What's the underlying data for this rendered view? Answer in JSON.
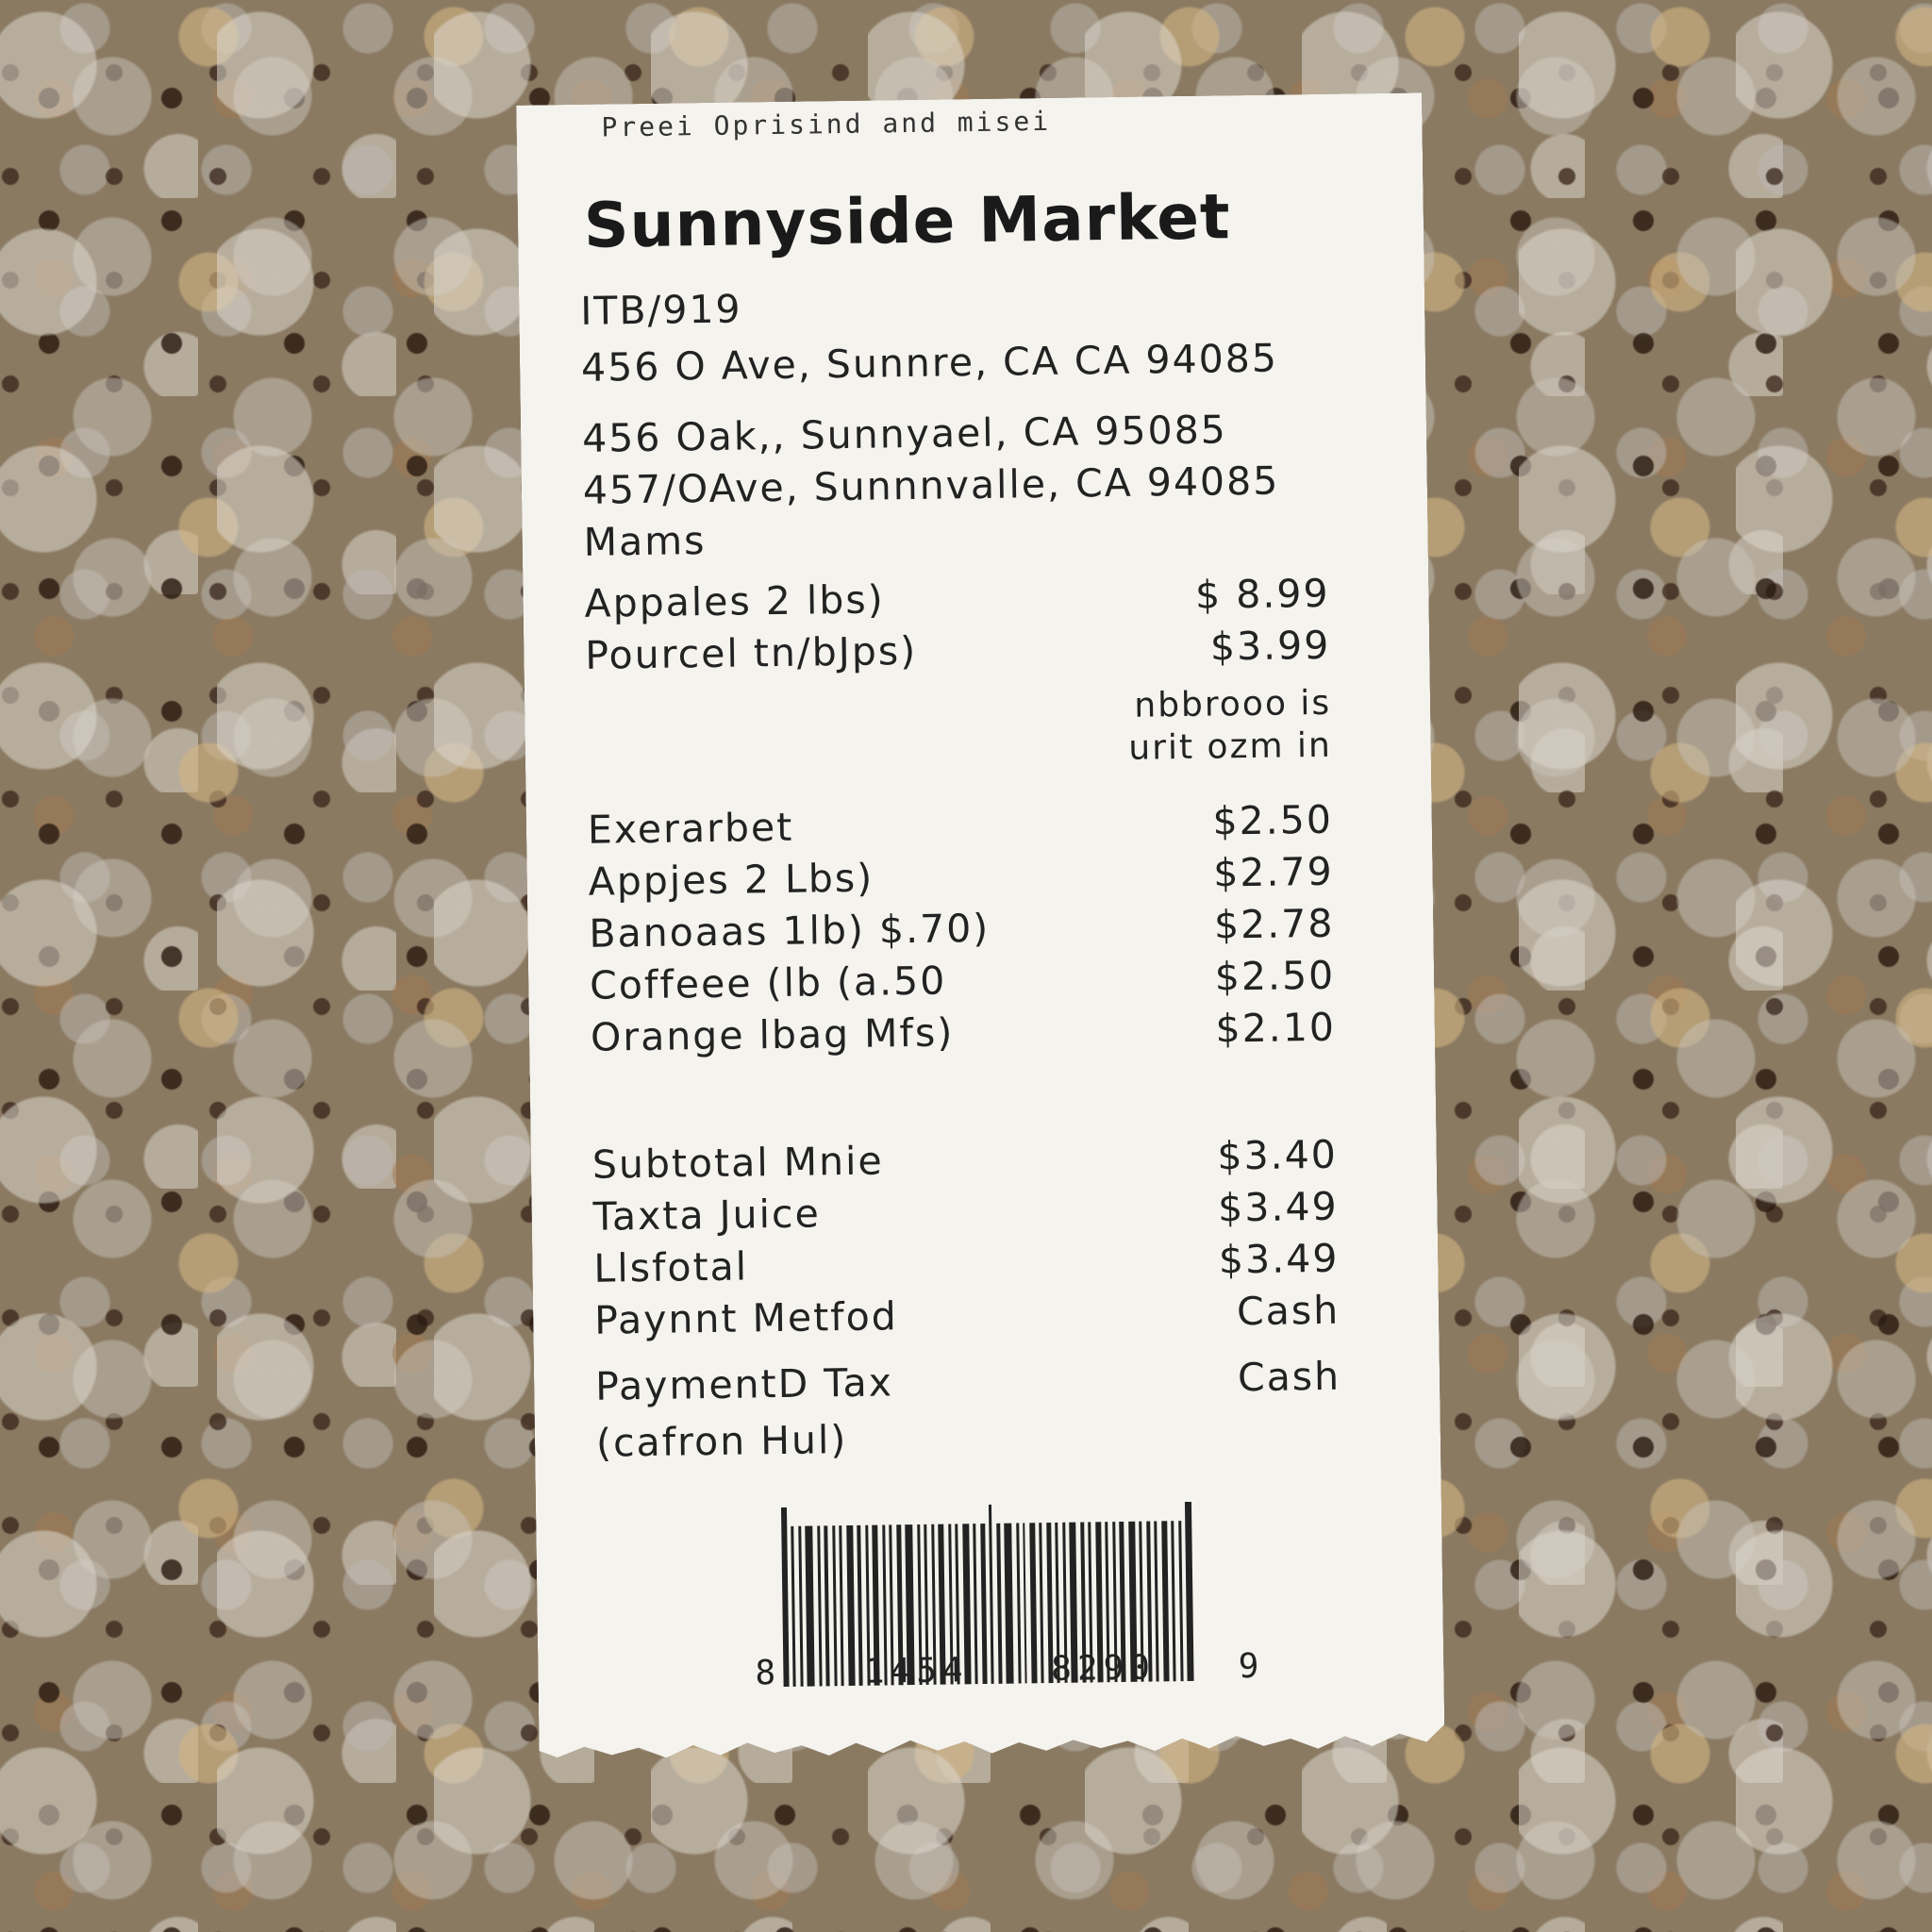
{
  "receipt": {
    "header_note": "Preei Oprisind and misei",
    "store_name": "Sunnyside Market",
    "code_line": "ITB/919",
    "address_lines": [
      "456 O Ave, Sunnre, CA CA 94085",
      "456 Oak,, Sunnyael, CA 95085",
      "457/OAve, Sunnnvalle, CA 94085",
      "Mams"
    ],
    "items": [
      {
        "name": "Appales 2 lbs)",
        "price": "$ 8.99"
      },
      {
        "name": "Pourcel tn/bJps)",
        "price": "$3.99"
      }
    ],
    "note_lines": [
      "nbbrooo is",
      "urit ozm in"
    ],
    "items2": [
      {
        "name": "Exerarbet",
        "price": "$2.50"
      },
      {
        "name": "Appjes 2 Lbs)",
        "price": "$2.79"
      },
      {
        "name": "Banoaas 1lb) $.70)",
        "price": "$2.78"
      },
      {
        "name": "Coffeee (lb (a.50",
        "price": "$2.50"
      },
      {
        "name": "Orange lbag Mfs)",
        "price": "$2.10"
      }
    ],
    "totals": [
      {
        "label": "Subtotal Mnie",
        "value": "$3.40"
      },
      {
        "label": "Taxta Juice",
        "value": "$3.49"
      },
      {
        "label": "Llsfotal",
        "value": "$3.49"
      },
      {
        "label": "Paynnt Metfod",
        "value": "Cash"
      },
      {
        "label": "PaymentD Tax",
        "value": "Cash"
      }
    ],
    "footer_line": "(cafron Hul)",
    "barcode_digits": [
      "8",
      "1454",
      "8290",
      "9"
    ]
  }
}
